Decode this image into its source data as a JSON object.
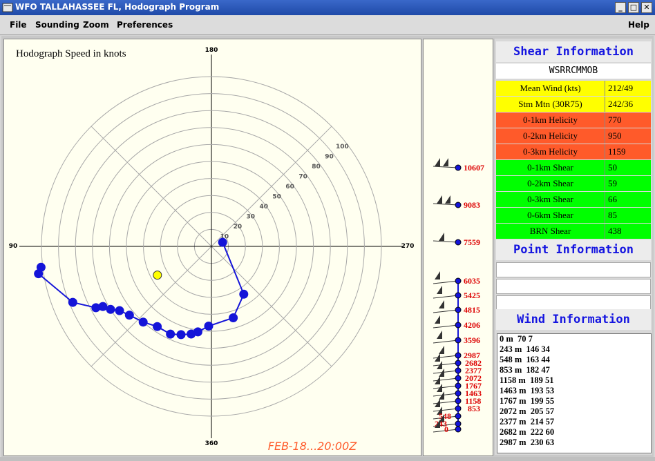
{
  "window": {
    "title": "WFO TALLAHASSEE FL, Hodograph Program",
    "minimize_icon": "minimize-icon",
    "maximize_icon": "maximize-icon",
    "close_icon": "close-icon"
  },
  "menu": {
    "file": "File",
    "sounding": "Sounding",
    "zoom": "Zoom",
    "preferences": "Preferences",
    "help": "Help"
  },
  "hodograph": {
    "title": "Hodograph Speed in knots",
    "dir_top": "180",
    "dir_left": "90",
    "dir_right": "270",
    "dir_bottom": "360",
    "timestamp": "FEB-18...20:00Z",
    "ring_labels": [
      "10",
      "20",
      "30",
      "40",
      "50",
      "60",
      "70",
      "80",
      "90",
      "100"
    ],
    "colors": {
      "path": "#1414d8",
      "storm": "#ffff00",
      "timestamp": "#ff5a2a"
    }
  },
  "chart_data": {
    "type": "scatter",
    "title": "Hodograph Speed in knots",
    "xlabel": "",
    "ylabel": "",
    "series": [
      {
        "values": [
          {
            "dir": 70,
            "spd": 7
          },
          {
            "dir": 146,
            "spd": 34
          },
          {
            "dir": 163,
            "spd": 44
          },
          {
            "dir": 182,
            "spd": 47
          },
          {
            "dir": 189,
            "spd": 51
          },
          {
            "dir": 193,
            "spd": 53
          },
          {
            "dir": 199,
            "spd": 55
          },
          {
            "dir": 205,
            "spd": 57
          },
          {
            "dir": 214,
            "spd": 57
          },
          {
            "dir": 222,
            "spd": 60
          },
          {
            "dir": 230,
            "spd": 63
          },
          {
            "dir": 235,
            "spd": 66
          },
          {
            "dir": 238,
            "spd": 70
          },
          {
            "dir": 241,
            "spd": 73
          },
          {
            "dir": 242,
            "spd": 77
          },
          {
            "dir": 248,
            "spd": 88
          },
          {
            "dir": 261,
            "spd": 103
          },
          {
            "dir": 263,
            "spd": 101
          }
        ]
      }
    ],
    "storm_motion": {
      "dir": 242,
      "spd": 36
    }
  },
  "barbs": {
    "heights": [
      "10607",
      "9083",
      "7559",
      "6035",
      "5425",
      "4815",
      "4206",
      "3596",
      "2987",
      "2682",
      "2377",
      "2072",
      "1767",
      "1463",
      "1158",
      "853",
      "548",
      "243",
      "0"
    ],
    "color": "#dd0000"
  },
  "shear": {
    "header": "Shear Information",
    "station": "WSRRCMMOB",
    "rows": [
      {
        "label": "Mean Wind (kts)",
        "value": "212/49",
        "color": "yellow"
      },
      {
        "label": "Stm Mtn (30R75)",
        "value": "242/36",
        "color": "yellow"
      },
      {
        "label": "0-1km Helicity",
        "value": "770",
        "color": "orange"
      },
      {
        "label": "0-2km Helicity",
        "value": "950",
        "color": "orange"
      },
      {
        "label": "0-3km Helicity",
        "value": "1159",
        "color": "orange"
      },
      {
        "label": "0-1km Shear",
        "value": "50",
        "color": "green"
      },
      {
        "label": "0-2km Shear",
        "value": "59",
        "color": "green"
      },
      {
        "label": "0-3km Shear",
        "value": "66",
        "color": "green"
      },
      {
        "label": "0-6km Shear",
        "value": "85",
        "color": "green"
      },
      {
        "label": "BRN Shear",
        "value": "438",
        "color": "green"
      }
    ]
  },
  "point": {
    "header": "Point Information"
  },
  "wind": {
    "header": "Wind Information",
    "lines": [
      "0 m  70 7",
      "243 m  146 34",
      "548 m  163 44",
      "853 m  182 47",
      "1158 m  189 51",
      "1463 m  193 53",
      "1767 m  199 55",
      "2072 m  205 57",
      "2377 m  214 57",
      "2682 m  222 60",
      "2987 m  230 63"
    ]
  }
}
